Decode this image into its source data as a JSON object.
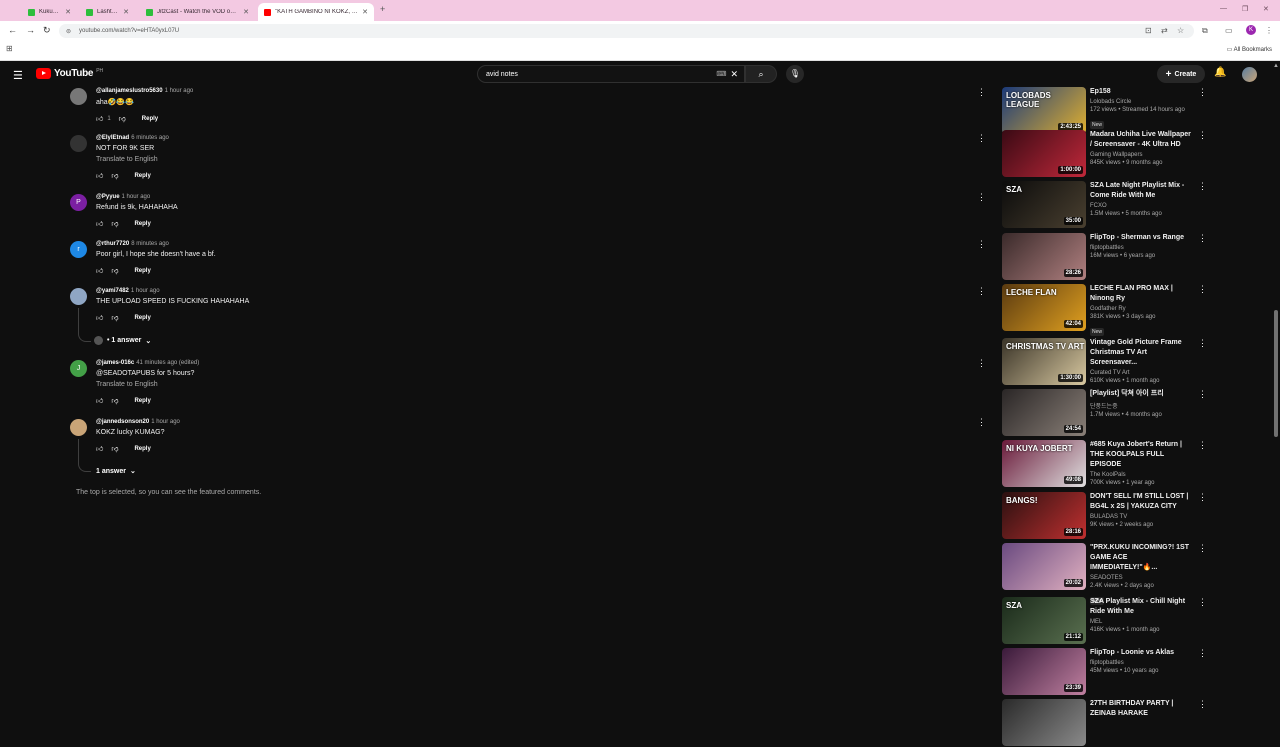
{
  "browser": {
    "tabs": [
      {
        "label": "KukuDot",
        "color": "#2dbe3c"
      },
      {
        "label": "Lashtags",
        "color": "#2dbe3c"
      },
      {
        "label": "JitzCast - Watch the VOD on Ki...",
        "color": "#2dbe3c"
      },
      {
        "label": "\"KATH GAMBINO NI KOKZ, NA...",
        "color": "#ff0000"
      }
    ],
    "url": "youtube.com/watch?v=eHTA0yxL07U",
    "bookmarks_label": "All Bookmarks",
    "profile_letter": "K"
  },
  "youtube": {
    "logo_text": "YouTube",
    "country": "PH",
    "search_value": "avid notes",
    "create_label": "Create"
  },
  "comments": [
    {
      "author": "@allanjameslustro5630",
      "time": "1 hour ago",
      "text": "aha🤣😂😂",
      "likes": "1",
      "reply": "Reply",
      "avatar_color": "#777777",
      "avatar_letter": ""
    },
    {
      "author": "@ElylEtnad",
      "time": "6 minutes ago",
      "text": "NOT FOR 9K SER",
      "translate": "Translate to English",
      "reply": "Reply",
      "avatar_color": "#333333",
      "avatar_letter": ""
    },
    {
      "author": "@Pyyue",
      "time": "1 hour ago",
      "text": "Refund is 9k, HAHAHAHA",
      "reply": "Reply",
      "avatar_color": "#7b1fa2",
      "avatar_letter": "P"
    },
    {
      "author": "@rthur7720",
      "time": "8 minutes ago",
      "text": "Poor girl, I hope she doesn't have a bf.",
      "reply": "Reply",
      "avatar_color": "#1e88e5",
      "avatar_letter": "r"
    },
    {
      "author": "@yami7482",
      "time": "1 hour ago",
      "text": "THE UPLOAD SPEED IS FUCKING HAHAHAHA",
      "reply": "Reply",
      "avatar_color": "#8fa6c4",
      "avatar_letter": "",
      "answers": "• 1 answer"
    },
    {
      "author": "@james-016c",
      "time": "41 minutes ago (edited)",
      "text": "@SEADOTAPUBS for 5 hours?",
      "translate": "Translate to English",
      "reply": "Reply",
      "avatar_color": "#43a047",
      "avatar_letter": "J"
    },
    {
      "author": "@jannedsonson20",
      "time": "1 hour ago",
      "text": "KOKZ lucky KUMAG?",
      "reply": "Reply",
      "avatar_color": "#c9a477",
      "avatar_letter": "",
      "answers": "1 answer"
    }
  ],
  "top_note": "The top is selected, so you can see the featured comments.",
  "sidebar": [
    {
      "title": "Ep158",
      "channel": "Lolobads Circle",
      "meta": "172 views • Streamed 14 hours ago",
      "badge": "New",
      "duration": "2:43:25",
      "thumb_text": "LOLOBADS LEAGUE",
      "colors": [
        "#1b3a7a",
        "#e0b030"
      ]
    },
    {
      "title": "Madara Uchiha Live Wallpaper / Screensaver - 4K Ultra HD",
      "channel": "Gaming Wallpapers",
      "meta": "845K views • 9 months ago",
      "duration": "1:00:00",
      "thumb_text": "",
      "colors": [
        "#3a0a14",
        "#c0283a"
      ]
    },
    {
      "title": "SZA Late Night Playlist Mix - Come Ride With Me",
      "channel": "FCXO",
      "meta": "1.5M views • 5 months ago",
      "duration": "35:00",
      "thumb_text": "SZA",
      "colors": [
        "#0b0b0b",
        "#4a4030"
      ]
    },
    {
      "title": "FlipTop - Sherman vs Range",
      "channel": "fliptopbattles",
      "meta": "16M views • 6 years ago",
      "duration": "28:26",
      "thumb_text": "",
      "colors": [
        "#3a2a2a",
        "#b08080"
      ]
    },
    {
      "title": "LECHE FLAN PRO MAX | Ninong Ry",
      "channel": "Godfather Ry",
      "meta": "381K views • 3 days ago",
      "badge": "New",
      "duration": "42:04",
      "thumb_text": "LECHE FLAN",
      "colors": [
        "#5a3a10",
        "#e0a020"
      ]
    },
    {
      "title": "Vintage Gold Picture Frame Christmas TV Art Screensaver...",
      "channel": "Curated TV Art",
      "meta": "610K views • 1 month ago",
      "duration": "1:30:00",
      "thumb_text": "CHRISTMAS TV ART",
      "colors": [
        "#3a3428",
        "#d8c8a0"
      ]
    },
    {
      "title": "[Playlist] 닥쳐 아이 프리",
      "channel": "단풍드는중",
      "meta": "1.7M views • 4 months ago",
      "duration": "24:54",
      "thumb_text": "",
      "colors": [
        "#2a2626",
        "#8a8078"
      ]
    },
    {
      "title": "#685 Kuya Jobert's Return | THE KOOLPALS FULL EPISODE",
      "channel": "The KoolPals",
      "meta": "700K views • 1 year ago",
      "duration": "49:08",
      "thumb_text": "NI KUYA JOBERT",
      "colors": [
        "#6a1a3a",
        "#e0e0e0"
      ]
    },
    {
      "title": "DON'T SELL I'M STILL LOST | BG4L x 2S | YAKUZA CITY",
      "channel": "BULADAS TV",
      "meta": "9K views • 2 weeks ago",
      "duration": "28:16",
      "thumb_text": "BANGS!",
      "colors": [
        "#2a1010",
        "#c03030"
      ]
    },
    {
      "title": "\"PRX.KUKU INCOMING?! 1ST GAME ACE IMMEDIATELY!\"🔥...",
      "channel": "SEADOTES",
      "meta": "2.4K views • 2 days ago",
      "badge": "New",
      "duration": "20:02",
      "thumb_text": "",
      "colors": [
        "#6a4a80",
        "#e0b0c0"
      ]
    },
    {
      "title": "SZA Playlist Mix - Chill Night Ride With Me",
      "channel": "MEL",
      "meta": "416K views • 1 month ago",
      "duration": "21:12",
      "thumb_text": "SZA",
      "colors": [
        "#1a2a1a",
        "#5a7050"
      ]
    },
    {
      "title": "FlipTop - Loonie vs Aklas",
      "channel": "fliptopbattles",
      "meta": "45M views • 10 years ago",
      "duration": "23:39",
      "thumb_text": "",
      "colors": [
        "#3a1a3a",
        "#c080a0"
      ]
    },
    {
      "title": "27TH BIRTHDAY PARTY | ZEINAB HARAKE",
      "channel": "",
      "meta": "",
      "duration": "",
      "thumb_text": "",
      "colors": [
        "#2a2a2a",
        "#8a8a8a"
      ]
    }
  ]
}
